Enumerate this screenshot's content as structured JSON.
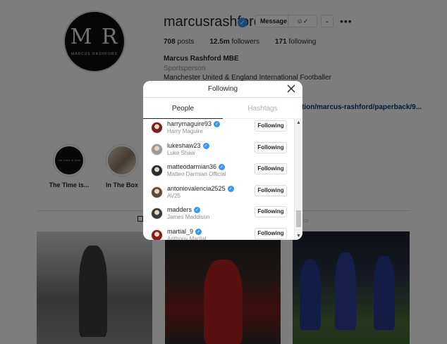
{
  "profile": {
    "avatar_text": "M R",
    "avatar_subtext": "MARCUS RASHFORD",
    "username": "marcusrashford",
    "message_label": "Message",
    "follow_label": "☺✓",
    "more_label": "⌄",
    "dots_label": "•••",
    "stats": {
      "posts_count": "708",
      "posts_label": "posts",
      "followers_count": "12.5m",
      "followers_label": "followers",
      "following_count": "171",
      "following_label": "following"
    },
    "full_name": "Marcus Rashford MBE",
    "category": "Sportsperson",
    "bio": "Manchester United & England International Footballer",
    "link": "tion/marcus-rashford/paperback/9..."
  },
  "highlights": [
    {
      "label": "The Time is...",
      "cover_text": "THE TIME IS NOW"
    },
    {
      "label": "In The Box"
    }
  ],
  "modal": {
    "title": "Following",
    "tabs": [
      {
        "label": "People",
        "active": true
      },
      {
        "label": "Hashtags",
        "active": false
      }
    ],
    "button_label": "Following",
    "scroll_up": "▲",
    "scroll_down": "▼",
    "users": [
      {
        "username": "harrymaguire93",
        "name": "Harry Maguire",
        "verified": true,
        "avatar_color": "#7a1f1f"
      },
      {
        "username": "lukeshaw23",
        "name": "Luke Shaw",
        "verified": true,
        "avatar_color": "#9a9a9a"
      },
      {
        "username": "matteodarmian36",
        "name": "Matteo Darmian Official",
        "verified": true,
        "avatar_color": "#2b2b2b"
      },
      {
        "username": "antoniovalencia2525",
        "name": "AV25",
        "verified": true,
        "avatar_color": "#5a4a3a"
      },
      {
        "username": "madders",
        "name": "James Maddison",
        "verified": true,
        "avatar_color": "#3a3a3a"
      },
      {
        "username": "martial_9",
        "name": "Anthony Martial",
        "verified": true,
        "avatar_color": "#8a1a1a"
      }
    ]
  },
  "colors": {
    "verified_blue": "#3897f0",
    "link_blue": "#00376b",
    "text_primary": "#262626",
    "text_secondary": "#8e8e8e"
  }
}
